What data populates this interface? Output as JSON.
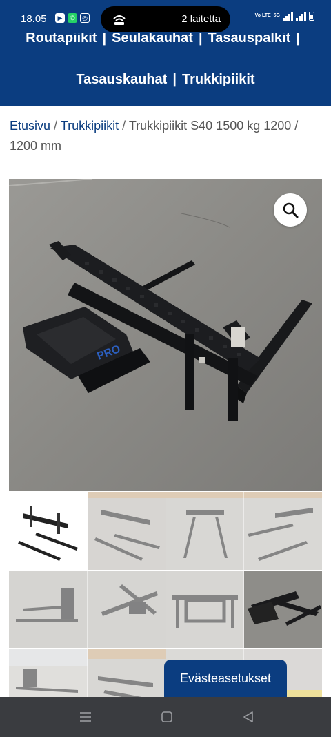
{
  "status_bar": {
    "time": "18.05",
    "island_text": "2 laitetta",
    "network_label": "Vo LTE",
    "network_type": "5G",
    "icons": [
      "youtube-icon",
      "whatsapp-icon",
      "instagram-icon",
      "hotspot-icon",
      "signal-icon",
      "battery-icon"
    ]
  },
  "nav": {
    "line1": [
      "Routapiikit",
      "Seulakauhat",
      "Tasauspalkit"
    ],
    "line2": [
      "Tasauskauhat",
      "Trukkipiikit"
    ],
    "separator": "|"
  },
  "breadcrumb": {
    "home": "Etusivu",
    "category": "Trukkipiikit",
    "current": "Trukkipiikit S40 1500 kg 1200 / 1200 mm",
    "separator": "/"
  },
  "gallery": {
    "zoom_icon": "magnifier-icon",
    "main_image_brand": "PRO",
    "thumbnail_count": 12
  },
  "cookie_button": {
    "label": "Evästeasetukset"
  },
  "colors": {
    "brand_blue": "#0b3d80",
    "nav_bar": "#3a3c40"
  }
}
